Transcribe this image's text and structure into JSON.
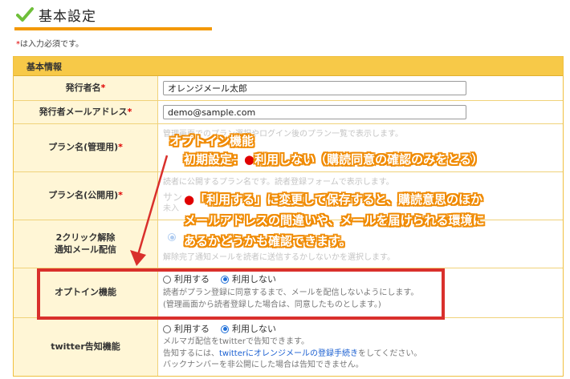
{
  "page": {
    "title": "基本設定",
    "required_note_star": "*",
    "required_note": "は入力必須です。"
  },
  "section": {
    "title": "基本情報"
  },
  "rows": {
    "sender_name": {
      "label": "発行者名",
      "value": "オレンジメール太郎"
    },
    "sender_email": {
      "label": "発行者メールアドレス",
      "value": "demo@sample.com"
    },
    "plan_name_admin": {
      "label": "プラン名(管理用)",
      "help": "管理画面でのプラン選択やログイン後のプラン一覧で表示します。"
    },
    "plan_name_public": {
      "label": "プラン名(公開用)",
      "help": "読者に公開するプラン名です。読者登録フォームで表示します。",
      "placeholder": "サン",
      "help2": "未入"
    },
    "two_click": {
      "label_line1": "2クリック解除",
      "label_line2": "通知メール配信",
      "help": "解除完了通知メールを読者に送信するかしないかを選択します。"
    },
    "optin": {
      "label": "オプトイン機能",
      "option_use": "利用する",
      "option_not_use": "利用しない",
      "selected": "利用しない",
      "help1": "読者がプラン登録に同意するまで、メールを配信しないようにします。",
      "help2": "(管理画面から読者登録した場合は、同意したものとします。)"
    },
    "twitter": {
      "label": "twitter告知機能",
      "option_use": "利用する",
      "option_not_use": "利用しない",
      "selected": "利用しない",
      "help1": "メルマガ配信をtwitterで告知できます。",
      "help2_pre": "告知するには、",
      "help2_link": "twitterにオレンジメールの登録手続き",
      "help2_post": "をしてください。",
      "help3": "バックナンバーを非公開にした場合は告知できません。"
    }
  },
  "callout": {
    "line1": "オプトイン機能",
    "line2_pre": "初期設定：",
    "line2_dot": "●",
    "line2_post": "利用しない（購読同意の確認のみをとる）",
    "line3_dot": "●",
    "line3_post": "「利用する」に変更して保存すると、購読意思のほか",
    "line4": "メールアドレスの間違いや、メールを届けられる環境に",
    "line5": "あるかどうかも確認できます。"
  },
  "colors": {
    "accent_orange": "#f39800",
    "header_yellow": "#f7c948",
    "label_bg": "#fff6d6",
    "highlight_red": "#d9302c",
    "radio_blue": "#1f6fd8",
    "link_blue": "#1a5fd1"
  },
  "icons": {
    "title_icon": "check-icon",
    "arrow": "arrow-down-icon"
  }
}
